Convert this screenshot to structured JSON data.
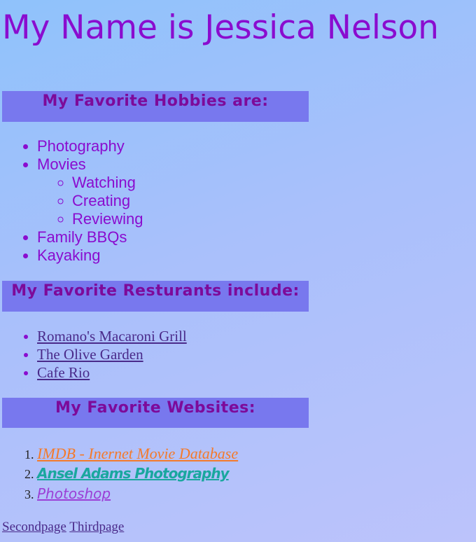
{
  "title": "My Name is Jessica Nelson",
  "hobbies": {
    "heading": "My Favorite Hobbies are:",
    "items": [
      "Photography",
      "Movies",
      "Family BBQs",
      "Kayaking"
    ],
    "movies_sub": [
      "Watching",
      "Creating",
      "Reviewing"
    ]
  },
  "restaurants": {
    "heading": "My Favorite Resturants include:",
    "items": [
      "Romano's Macaroni Grill",
      "The Olive Garden",
      "Cafe Rio"
    ]
  },
  "websites": {
    "heading": "My Favorite Websites:",
    "items": [
      "IMDB - Inernet Movie Database",
      "Ansel Adams Photography",
      "Photoshop"
    ]
  },
  "footer": {
    "links": [
      "Secondpage",
      "Thirdpage"
    ]
  }
}
